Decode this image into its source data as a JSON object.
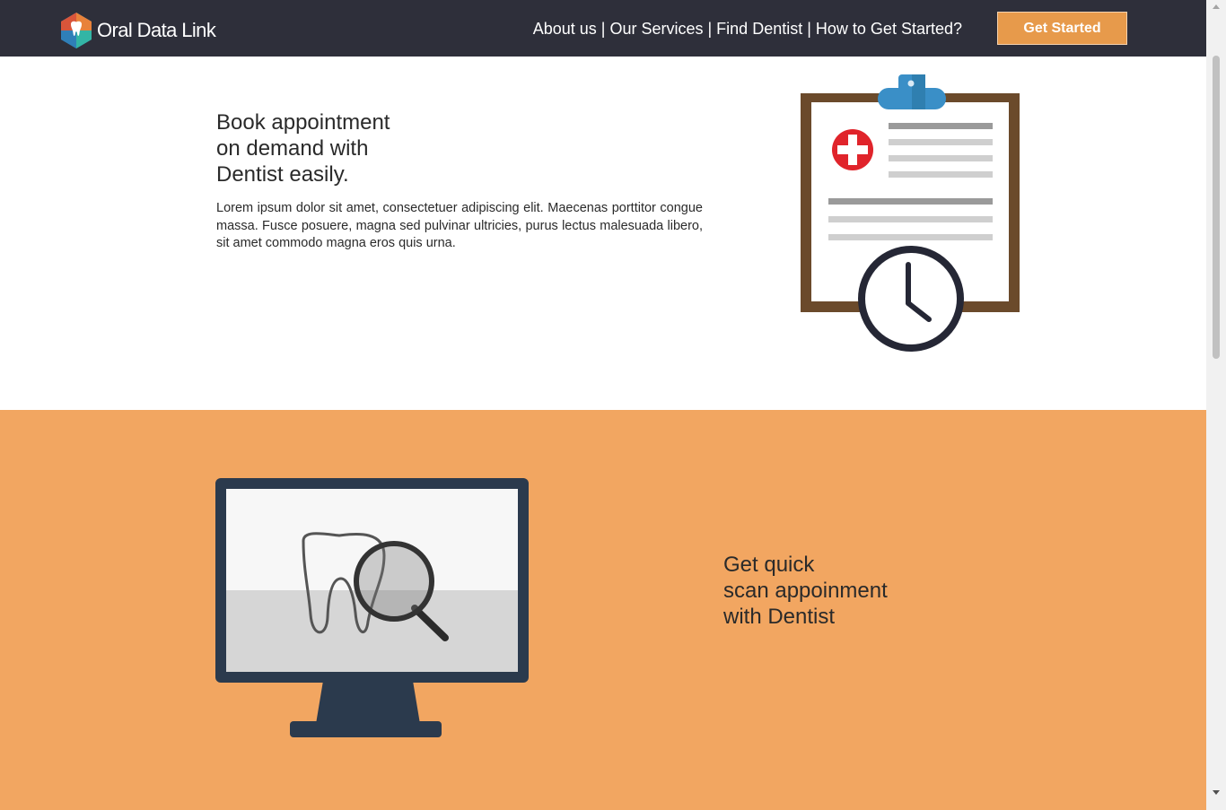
{
  "header": {
    "logo_text": "Oral Data Link",
    "nav": [
      {
        "label": "About us"
      },
      {
        "label": "Our Services"
      },
      {
        "label": "Find Dentist"
      },
      {
        "label": "How to Get Started?"
      }
    ],
    "nav_separator": "|",
    "cta_label": "Get Started"
  },
  "section1": {
    "heading_lines": [
      "Book appointment",
      "on demand with",
      "Dentist easily."
    ],
    "body": "Lorem ipsum dolor sit amet, consectetuer adipiscing elit. Maecenas porttitor congue massa. Fusce posuere, magna sed pulvinar ultricies, purus lectus malesuada libero, sit amet commodo magna eros quis urna.",
    "illustration_icon": "clipboard-clock-icon"
  },
  "section2": {
    "heading_lines": [
      "Get quick",
      "scan appoinment",
      "with Dentist"
    ],
    "illustration_icon": "monitor-tooth-scan-icon"
  },
  "colors": {
    "header_bg": "#2e2f3a",
    "accent_orange": "#e79a4b",
    "section_orange": "#f2a661",
    "text_dark": "#2a2a2a"
  }
}
